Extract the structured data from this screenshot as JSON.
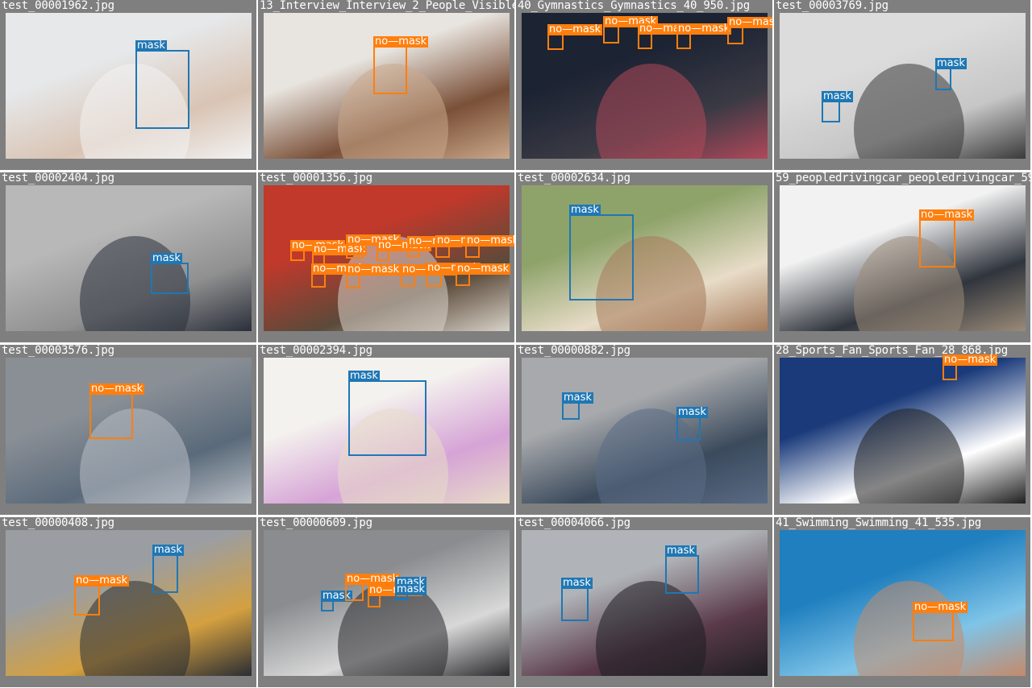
{
  "colors": {
    "mask": "#1f77b4",
    "no-mask": "#ff7f0e",
    "tile_background": "#7f7f7f",
    "filename_text": "#ffffff"
  },
  "class_labels": {
    "mask": "mask",
    "no-mask": "no—mask"
  },
  "tiles": [
    {
      "filename": "test_00001962.jpg",
      "photo": [
        "#e6e8ea",
        "#d9c4b4",
        "#f2f2f2"
      ],
      "boxes": [
        {
          "cls": "mask",
          "b": [
            168,
            62,
            67,
            98
          ]
        }
      ]
    },
    {
      "filename": "13_Interview_Interview_2_People_Visible_",
      "photo": [
        "#e8e4df",
        "#7a5038",
        "#caa88a"
      ],
      "boxes": [
        {
          "cls": "no-mask",
          "b": [
            463,
            57,
            42,
            60
          ]
        }
      ]
    },
    {
      "filename": "40_Gymnastics_Gymnastics_40_950.jpg",
      "photo": [
        "#1c2333",
        "#3a3a44",
        "#b0485a"
      ],
      "boxes": [
        {
          "cls": "no-mask",
          "b": [
            679,
            42,
            20,
            20
          ]
        },
        {
          "cls": "no-mask",
          "b": [
            748,
            32,
            20,
            22
          ]
        },
        {
          "cls": "no-mask",
          "b": [
            791,
            41,
            18,
            20
          ]
        },
        {
          "cls": "no-mask",
          "b": [
            839,
            41,
            18,
            20
          ]
        },
        {
          "cls": "no-mask",
          "b": [
            902,
            33,
            20,
            22
          ]
        }
      ]
    },
    {
      "filename": "test_00003769.jpg",
      "photo": [
        "#dcdcdc",
        "#c6c6c6",
        "#3a3a3a"
      ],
      "boxes": [
        {
          "cls": "mask",
          "b": [
            1019,
            125,
            23,
            27
          ]
        },
        {
          "cls": "mask",
          "b": [
            1160,
            84,
            20,
            28
          ]
        }
      ]
    },
    {
      "filename": "test_00002404.jpg",
      "photo": [
        "#b8b8b8",
        "#909090",
        "#2a2f3a"
      ],
      "boxes": [
        {
          "cls": "mask",
          "b": [
            187,
            326,
            47,
            39
          ]
        }
      ]
    },
    {
      "filename": "test_00001356.jpg",
      "photo": [
        "#c0392b",
        "#5b4a3a",
        "#d8d2c8"
      ],
      "boxes": [
        {
          "cls": "no-mask",
          "b": [
            360,
            310,
            18,
            14
          ]
        },
        {
          "cls": "no-mask",
          "b": [
            387,
            315,
            16,
            14
          ]
        },
        {
          "cls": "no-mask",
          "b": [
            429,
            303,
            22,
            18
          ]
        },
        {
          "cls": "no-mask",
          "b": [
            467,
            310,
            16,
            14
          ]
        },
        {
          "cls": "no-mask",
          "b": [
            505,
            305,
            16,
            14
          ]
        },
        {
          "cls": "no-mask",
          "b": [
            540,
            304,
            18,
            16
          ]
        },
        {
          "cls": "no-mask",
          "b": [
            577,
            304,
            18,
            16
          ]
        },
        {
          "cls": "no-mask",
          "b": [
            386,
            339,
            18,
            18
          ]
        },
        {
          "cls": "no-mask",
          "b": [
            429,
            340,
            18,
            18
          ]
        },
        {
          "cls": "no-mask",
          "b": [
            497,
            340,
            18,
            16
          ]
        },
        {
          "cls": "no-mask",
          "b": [
            528,
            338,
            20,
            18
          ]
        },
        {
          "cls": "no-mask",
          "b": [
            565,
            339,
            18,
            16
          ]
        }
      ]
    },
    {
      "filename": "test_00002634.jpg",
      "photo": [
        "#8ea36a",
        "#e8dcc8",
        "#a67a5a"
      ],
      "boxes": [
        {
          "cls": "mask",
          "b": [
            706,
            266,
            80,
            107
          ]
        }
      ]
    },
    {
      "filename": "59_peopledrivingcar_peopledrivingcar_59",
      "photo": [
        "#f2f2f2",
        "#30353d",
        "#9a8a78"
      ],
      "boxes": [
        {
          "cls": "no-mask",
          "b": [
            1140,
            272,
            45,
            60
          ]
        }
      ]
    },
    {
      "filename": "test_00003576.jpg",
      "photo": [
        "#8a8f96",
        "#5a6a7a",
        "#b8bdc4"
      ],
      "boxes": [
        {
          "cls": "no-mask",
          "b": [
            111,
            488,
            54,
            57
          ]
        }
      ]
    },
    {
      "filename": "test_00002394.jpg",
      "photo": [
        "#f4f2ee",
        "#d6a3d6",
        "#e8dcc8"
      ],
      "boxes": [
        {
          "cls": "mask",
          "b": [
            432,
            472,
            97,
            94
          ]
        }
      ]
    },
    {
      "filename": "test_00000882.jpg",
      "photo": [
        "#a7a9ac",
        "#3b4a5c",
        "#596b85"
      ],
      "boxes": [
        {
          "cls": "mask",
          "b": [
            697,
            499,
            22,
            22
          ]
        },
        {
          "cls": "mask",
          "b": [
            839,
            517,
            30,
            30
          ]
        }
      ]
    },
    {
      "filename": "28_Sports_Fan_Sports_Fan_28_868.jpg",
      "photo": [
        "#1a3a7a",
        "#ffffff",
        "#202020"
      ],
      "boxes": [
        {
          "cls": "no-mask",
          "b": [
            1169,
            452,
            18,
            20
          ]
        }
      ]
    },
    {
      "filename": "test_00000408.jpg",
      "photo": [
        "#9a9ea3",
        "#d4a040",
        "#2a2d33"
      ],
      "boxes": [
        {
          "cls": "mask",
          "b": [
            189,
            688,
            32,
            48
          ]
        },
        {
          "cls": "no-mask",
          "b": [
            92,
            726,
            32,
            38
          ]
        }
      ]
    },
    {
      "filename": "test_00000609.jpg",
      "photo": [
        "#8a8c8f",
        "#d8d8d8",
        "#2a2a2e"
      ],
      "boxes": [
        {
          "cls": "mask",
          "b": [
            398,
            745,
            16,
            14
          ]
        },
        {
          "cls": "no-mask",
          "b": [
            428,
            724,
            23,
            22
          ]
        },
        {
          "cls": "no-mask",
          "b": [
            456,
            738,
            16,
            16
          ]
        },
        {
          "cls": "mask",
          "b": [
            490,
            728,
            16,
            16
          ]
        },
        {
          "cls": "mask",
          "b": [
            490,
            737,
            16,
            8
          ]
        }
      ]
    },
    {
      "filename": "test_00004066.jpg",
      "photo": [
        "#b0b4b8",
        "#5a3a4a",
        "#1e1e22"
      ],
      "boxes": [
        {
          "cls": "mask",
          "b": [
            696,
            729,
            34,
            42
          ]
        },
        {
          "cls": "mask",
          "b": [
            825,
            689,
            42,
            48
          ]
        }
      ]
    },
    {
      "filename": "41_Swimming_Swimming_41_535.jpg",
      "photo": [
        "#1f7fbf",
        "#7fc4e8",
        "#c48a6a"
      ],
      "boxes": [
        {
          "cls": "no-mask",
          "b": [
            1132,
            759,
            51,
            37
          ]
        }
      ]
    }
  ]
}
